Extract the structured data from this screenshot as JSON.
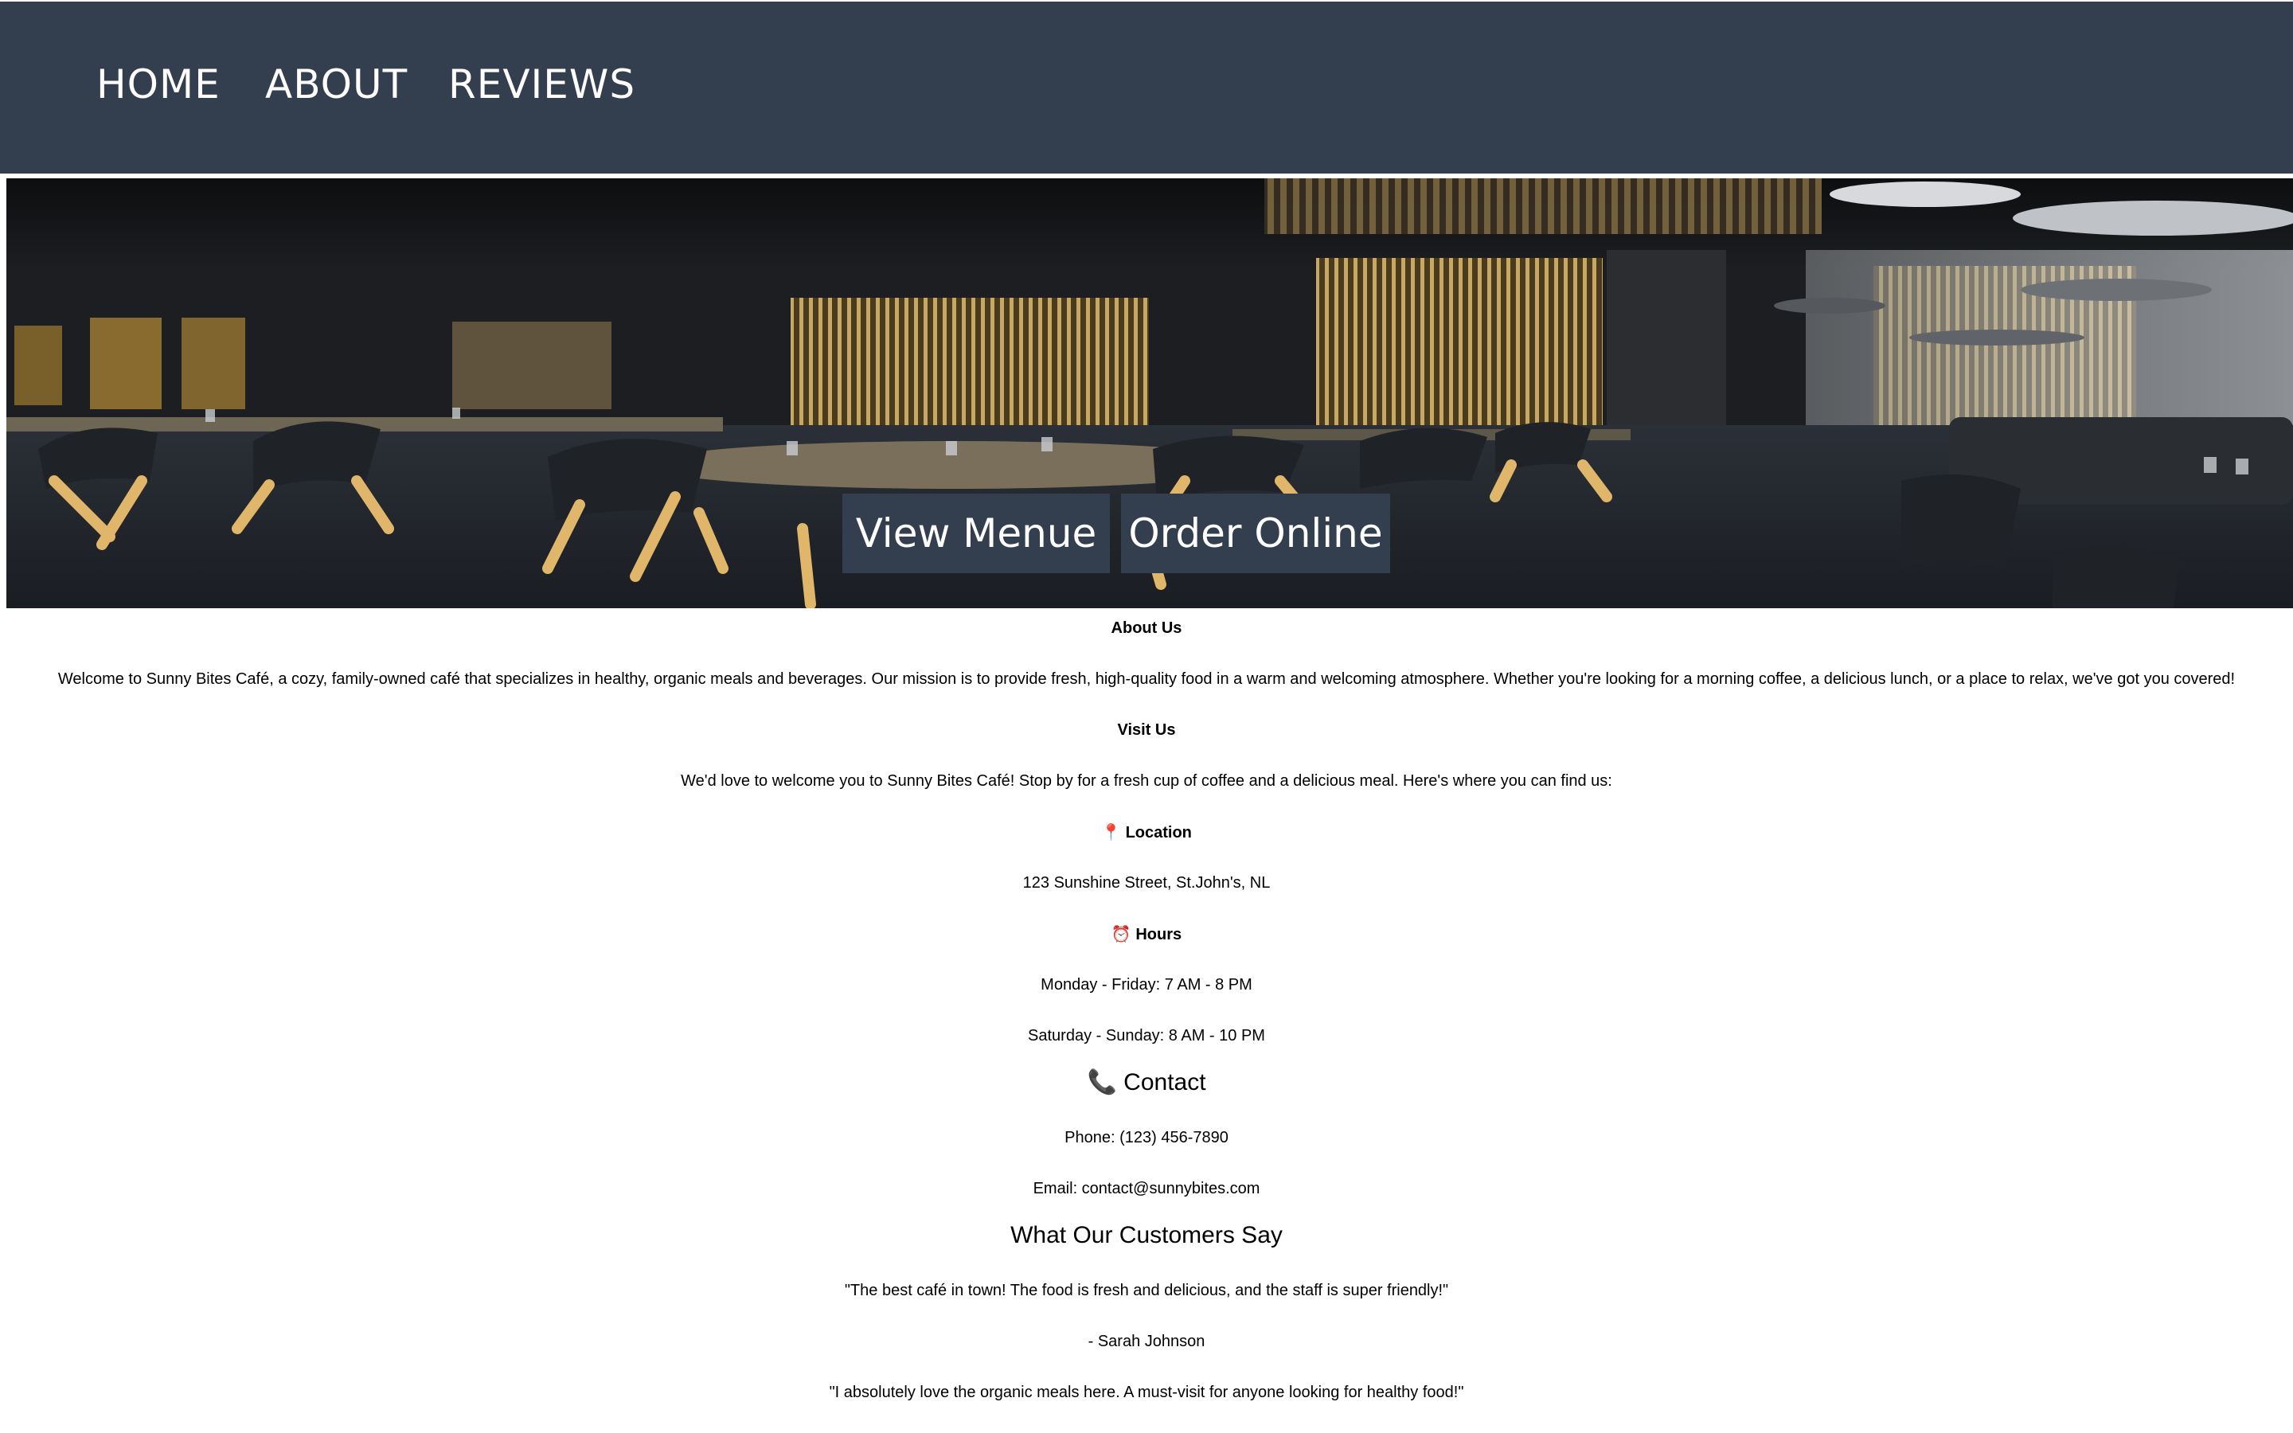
{
  "nav": {
    "home": "HOME",
    "about": "ABOUT",
    "reviews": "REVIEWS"
  },
  "hero": {
    "view_menu": "View Menue",
    "order_online": "Order Online"
  },
  "about": {
    "heading": "About Us",
    "text": "Welcome to Sunny Bites Café, a cozy, family-owned café that specializes in healthy, organic meals and beverages. Our mission is to provide fresh, high-quality food in a warm and welcoming atmosphere. Whether you're looking for a morning coffee, a delicious lunch, or a place to relax, we've got you covered!"
  },
  "visit": {
    "heading": "Visit Us",
    "intro": "We'd love to welcome you to Sunny Bites Café! Stop by for a fresh cup of coffee and a delicious meal. Here's where you can find us:",
    "location_icon": "📍",
    "location_label": "Location",
    "address": "123 Sunshine Street, St.John's, NL",
    "hours_icon": "⏰",
    "hours_label": "Hours",
    "weekday_hours": "Monday - Friday: 7 AM - 8 PM",
    "weekend_hours": "Saturday - Sunday: 8 AM - 10 PM"
  },
  "contact": {
    "icon": "📞",
    "heading": "Contact",
    "phone": "Phone: (123) 456-7890",
    "email": "Email: contact@sunnybites.com"
  },
  "reviews": {
    "heading": "What Our Customers Say",
    "items": [
      {
        "quote": "\"The best café in town! The food is fresh and delicious, and the staff is super friendly!\"",
        "author": "- Sarah Johnson"
      },
      {
        "quote": "\"I absolutely love the organic meals here. A must-visit for anyone looking for healthy food!\""
      }
    ]
  },
  "colors": {
    "nav_background": "#333f4f",
    "button_background": "#333f4f",
    "nav_text": "#ffffff"
  }
}
